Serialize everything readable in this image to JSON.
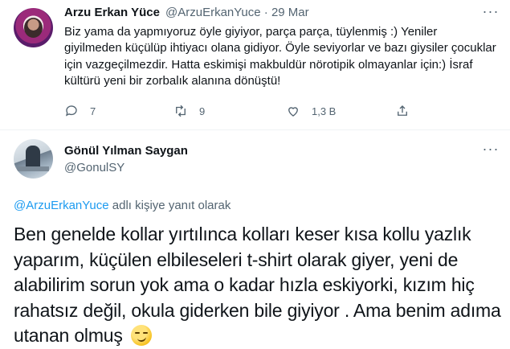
{
  "tweet1": {
    "name": "Arzu Erkan Yüce",
    "handle_date": "@ArzuErkanYuce · 29 Mar",
    "text": "Biz yama da yapmıyoruz öyle giyiyor, parça parça, tüylenmiş :) Yeniler giyilmeden küçülüp ihtiyacı olana gidiyor. Öyle seviyorlar ve bazı giysiler çocuklar için vazgeçilmezdir. Hatta eskimişi makbuldür nörotipik olmayanlar için:) İsraf kültürü yeni bir zorbalık alanına dönüştü!",
    "actions": {
      "reply_count": "7",
      "retweet_count": "9",
      "like_count": "1,3 B"
    }
  },
  "tweet2": {
    "name": "Gönül Yılman Saygan",
    "handle": "@GonulSY",
    "reply_to_handle": "@ArzuErkanYuce",
    "reply_to_suffix": " adlı kişiye yanıt olarak",
    "text": "Ben genelde kollar yırtılınca kolları keser kısa kollu yazlık yaparım, küçülen elbileseleri t-shirt olarak giyer, yeni de alabilirim sorun yok ama o kadar hızla eskiyorki, kızım hiç rahatsız değil, okula giderken bile giyiyor . Ama benim adıma utanan olmuş"
  },
  "icons": {
    "more": "more-horizontal-icon",
    "reply": "reply-icon",
    "retweet": "retweet-icon",
    "like": "heart-icon",
    "share": "share-icon",
    "emoji": "smirking-face-emoji"
  },
  "colors": {
    "link": "#1d9bf0",
    "secondary_text": "#536471",
    "primary_text": "#0f1419"
  }
}
